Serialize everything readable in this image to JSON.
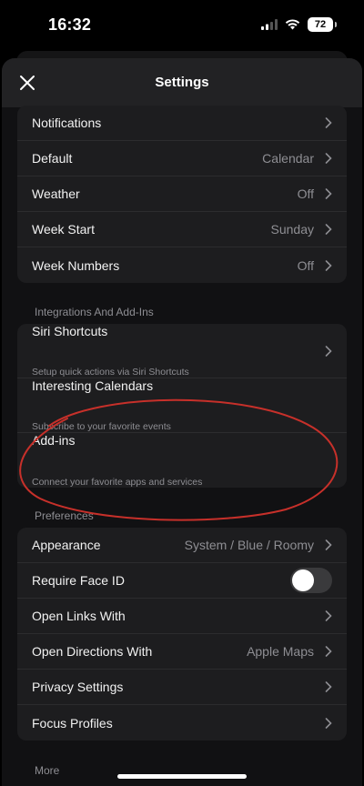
{
  "status_bar": {
    "time": "16:32",
    "battery": "72"
  },
  "nav": {
    "title": "Settings"
  },
  "general": [
    {
      "label": "Notifications",
      "value": ""
    },
    {
      "label": "Default",
      "value": "Calendar"
    },
    {
      "label": "Weather",
      "value": "Off"
    },
    {
      "label": "Week Start",
      "value": "Sunday"
    },
    {
      "label": "Week Numbers",
      "value": "Off"
    }
  ],
  "integrations": {
    "header": "Integrations And Add-Ins",
    "items": [
      {
        "label": "Siri Shortcuts",
        "sub": "Setup quick actions via Siri Shortcuts"
      },
      {
        "label": "Interesting Calendars",
        "sub": "Subscribe to your favorite events"
      },
      {
        "label": "Add-ins",
        "sub": "Connect your favorite apps and services"
      }
    ]
  },
  "preferences": {
    "header": "Preferences",
    "items": [
      {
        "label": "Appearance",
        "value": "System / Blue / Roomy"
      },
      {
        "label": "Require Face ID",
        "value": ""
      },
      {
        "label": "Open Links With",
        "value": ""
      },
      {
        "label": "Open Directions With",
        "value": "Apple Maps"
      },
      {
        "label": "Privacy Settings",
        "value": ""
      },
      {
        "label": "Focus Profiles",
        "value": ""
      }
    ]
  },
  "more": {
    "header": "More"
  },
  "colors": {
    "annotation": "#c7302a",
    "background": "#000000",
    "card": "#1d1d1f"
  }
}
